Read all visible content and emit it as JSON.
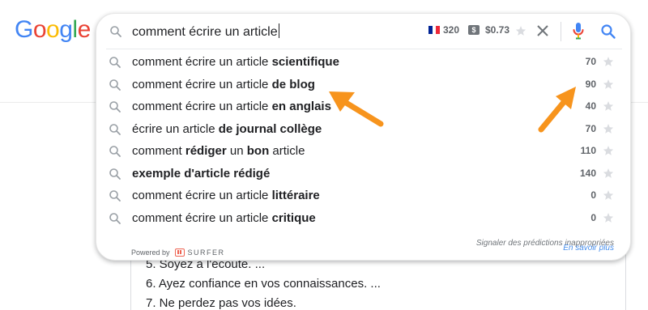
{
  "logo": {
    "letters": [
      {
        "char": "G",
        "color": "#4285F4"
      },
      {
        "char": "o",
        "color": "#EA4335"
      },
      {
        "char": "o",
        "color": "#FBBC05"
      },
      {
        "char": "g",
        "color": "#4285F4"
      },
      {
        "char": "l",
        "color": "#34A853"
      },
      {
        "char": "e",
        "color": "#EA4335"
      }
    ]
  },
  "search": {
    "query": "comment écrire un article",
    "volume": "320",
    "cpc": "$0.73",
    "dollar_badge": "$",
    "icons": {
      "search": "search-icon",
      "flag": "france-flag-icon",
      "star": "star-icon",
      "clear": "close-icon",
      "mic": "microphone-icon",
      "submit": "search-icon"
    }
  },
  "suggestions": [
    {
      "prefix": "comment écrire un article ",
      "bold": "scientifique",
      "suffix": "",
      "volume": "70"
    },
    {
      "prefix": "comment écrire un article ",
      "bold": "de blog",
      "suffix": "",
      "volume": "90"
    },
    {
      "prefix": "comment écrire un article ",
      "bold": "en anglais",
      "suffix": "",
      "volume": "40"
    },
    {
      "prefix": "écrire un article ",
      "bold": "de journal collège",
      "suffix": "",
      "volume": "70"
    },
    {
      "prefix": "comment ",
      "bold": "rédiger",
      "suffix": " un ",
      "bold2": "bon",
      "suffix2": " article",
      "volume": "110"
    },
    {
      "prefix": "",
      "bold": "exemple d'article rédigé",
      "suffix": "",
      "volume": "140"
    },
    {
      "prefix": "comment écrire un article ",
      "bold": "littéraire",
      "suffix": "",
      "volume": "0"
    },
    {
      "prefix": "comment écrire un article ",
      "bold": "critique",
      "suffix": "",
      "volume": "0"
    }
  ],
  "footer": {
    "powered_by": "Powered by",
    "brand": "SURFER",
    "report": "Signaler des prédictions inappropriées",
    "learn_more": "En savoir plus"
  },
  "background": {
    "lines": [
      "5. Soyez à l'écoute. ...",
      "6. Ayez confiance en vos connaissances. ...",
      "7. Ne perdez pas vos idées."
    ]
  },
  "colors": {
    "arrow": "#F7941D",
    "flag_blue": "#002395",
    "flag_white": "#FFFFFF",
    "flag_red": "#ED2939"
  }
}
